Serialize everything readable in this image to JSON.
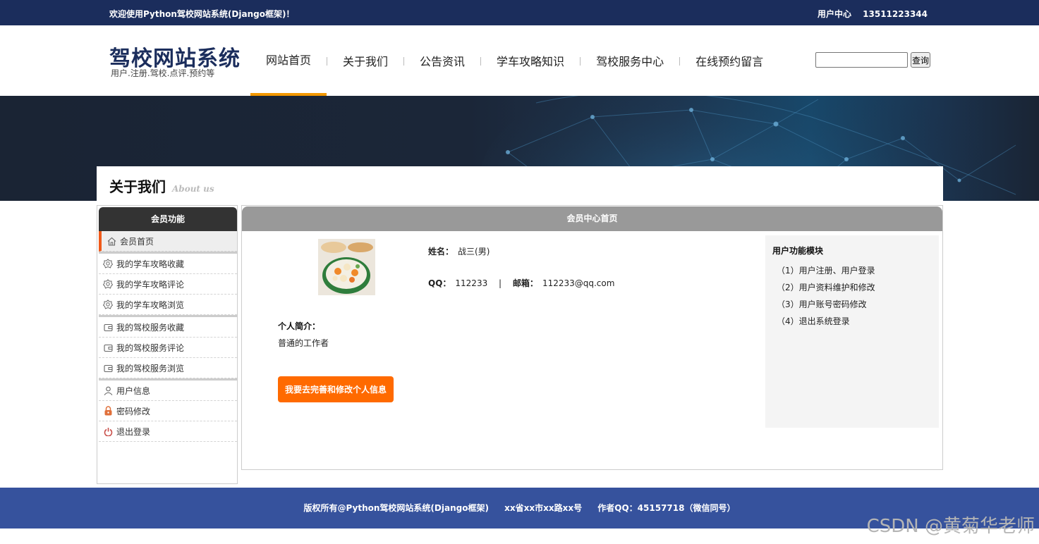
{
  "topbar": {
    "welcome": "欢迎使用Python驾校网站系统(Django框架)！",
    "user_center": "用户中心",
    "phone": "13511223344"
  },
  "header": {
    "logo_title": "驾校网站系统",
    "logo_sub": "用户.注册.驾校.点评.预约等",
    "nav": [
      {
        "label": "网站首页"
      },
      {
        "label": "关于我们"
      },
      {
        "label": "公告资讯"
      },
      {
        "label": "学车攻略知识"
      },
      {
        "label": "驾校服务中心"
      },
      {
        "label": "在线预约留言"
      }
    ],
    "search_value": "",
    "search_button": "查询"
  },
  "page_title": {
    "main": "关于我们",
    "sub": "About us"
  },
  "sidebar": {
    "title": "会员功能",
    "items": [
      {
        "label": "会员首页",
        "icon": "home-icon"
      },
      {
        "label": "我的学车攻略收藏",
        "icon": "badge-icon"
      },
      {
        "label": "我的学车攻略评论",
        "icon": "badge-icon"
      },
      {
        "label": "我的学车攻略浏览",
        "icon": "badge-icon"
      },
      {
        "label": "我的驾校服务收藏",
        "icon": "wallet-icon"
      },
      {
        "label": "我的驾校服务评论",
        "icon": "wallet-icon"
      },
      {
        "label": "我的驾校服务浏览",
        "icon": "wallet-icon"
      },
      {
        "label": "用户信息",
        "icon": "user-icon"
      },
      {
        "label": "密码修改",
        "icon": "lock-icon"
      },
      {
        "label": "退出登录",
        "icon": "power-icon"
      }
    ]
  },
  "main": {
    "title": "会员中心首页",
    "name_label": "姓名：",
    "name_value": "战三(男)",
    "qq_label": "QQ：",
    "qq_value": "112233",
    "separator": "|",
    "email_label": "邮箱：",
    "email_value": "112233@qq.com",
    "intro_label": "个人简介：",
    "intro_text": "普通的工作者",
    "edit_button": "我要去完善和修改个人信息",
    "func_title": "用户功能模块",
    "func_items": [
      "（1）用户注册、用户登录",
      "（2）用户资料维护和修改",
      "（3）用户账号密码修改",
      "（4）退出系统登录"
    ]
  },
  "footer": {
    "copyright": "版权所有@Python驾校网站系统(Django框架)",
    "address": "xx省xx市xx路xx号",
    "author": "作者QQ：45157718（微信同号）"
  },
  "watermark": "CSDN @黄菊华老师",
  "colors": {
    "topbar": "#1b2d5c",
    "accent_orange": "#ff6a00",
    "nav_active": "#f39800",
    "footer": "#36529d"
  }
}
